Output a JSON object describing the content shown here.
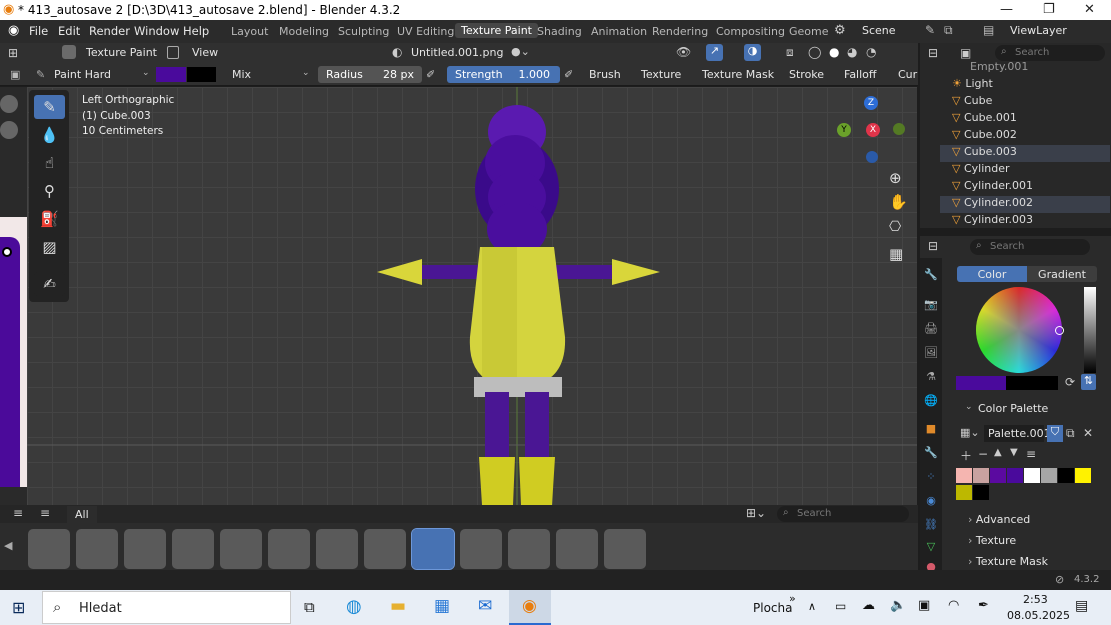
{
  "titlebar": {
    "title": "* 413_autosave 2 [D:\\3D\\413_autosave 2.blend] - Blender 4.3.2",
    "min": "—",
    "max": "❐",
    "close": "✕"
  },
  "menu": [
    "File",
    "Edit",
    "Render",
    "Window",
    "Help"
  ],
  "workspaces": [
    "Layout",
    "Modeling",
    "Sculpting",
    "UV Editing",
    "Texture Paint",
    "Shading",
    "Animation",
    "Rendering",
    "Compositing",
    "Geome"
  ],
  "scene": {
    "label": "Scene",
    "viewlayer": "ViewLayer"
  },
  "header": {
    "mode": "Texture Paint",
    "view": "View",
    "image": "Untitled.001.png",
    "brush_name": "Paint Hard",
    "blend": "Mix",
    "radius_label": "Radius",
    "radius_value": "28 px",
    "strength_label": "Strength",
    "strength_value": "1.000",
    "brush_menu": "Brush",
    "texture_menu": "Texture",
    "texture_mask_menu": "Texture Mask",
    "stroke_menu": "Stroke",
    "falloff_menu": "Falloff",
    "cursor_menu": "Cur",
    "colors": {
      "primary": "#4a0a9c",
      "secondary": "#000000"
    }
  },
  "viewport": {
    "view_name": "Left Orthographic",
    "object": "(1) Cube.003",
    "scale": "10 Centimeters"
  },
  "gizmo": {
    "z": "Z",
    "y": "Y",
    "x": "X"
  },
  "outliner": {
    "search_placeholder": "Search",
    "items": [
      {
        "name": "Empty.001"
      },
      {
        "name": "Light"
      },
      {
        "name": "Cube"
      },
      {
        "name": "Cube.001"
      },
      {
        "name": "Cube.002"
      },
      {
        "name": "Cube.003"
      },
      {
        "name": "Cylinder"
      },
      {
        "name": "Cylinder.001"
      },
      {
        "name": "Cylinder.002"
      },
      {
        "name": "Cylinder.003"
      }
    ]
  },
  "properties": {
    "search_placeholder": "Search",
    "tab_color": "Color",
    "tab_gradient": "Gradient",
    "palette_header": "Color Palette",
    "palette_name": "Palette.001",
    "palette_colors": [
      "#f5b5b0",
      "#c9a2a0",
      "#5b0aa0",
      "#4a0a9c",
      "#ffffff",
      "#a6a6a6",
      "#000000",
      "#fff200",
      "#bdb800",
      "#000000"
    ],
    "sections": [
      "Advanced",
      "Texture",
      "Texture Mask"
    ]
  },
  "shelf": {
    "all_label": "All",
    "search_placeholder": "Search"
  },
  "status": {
    "version": "4.3.2"
  },
  "taskbar": {
    "search": "Hledat",
    "desktop": "Plocha",
    "time": "2:53",
    "date": "08.05.2025"
  }
}
